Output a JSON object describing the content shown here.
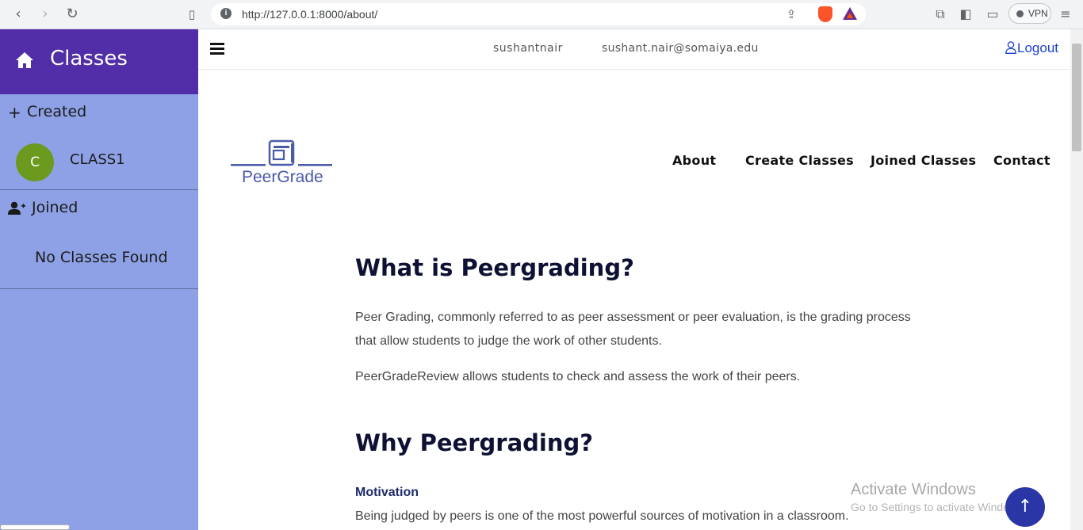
{
  "browser": {
    "url": "http://127.0.0.1:8000/about/",
    "vpn_label": "VPN"
  },
  "sidebar": {
    "title": "Classes",
    "created_label": "Created",
    "classes": [
      {
        "initial": "C",
        "name": "CLASS1",
        "avatar_color": "#6b9a1f"
      }
    ],
    "joined_label": "Joined",
    "no_classes": "No Classes Found"
  },
  "topbar": {
    "username": "sushantnair",
    "email": "sushant.nair@somaiya.edu",
    "logout": "Logout"
  },
  "site": {
    "logo_text": "PeerGrade",
    "nav": [
      "About",
      "Create Classes",
      "Joined Classes",
      "Contact"
    ]
  },
  "content": {
    "heading1": "What is Peergrading?",
    "para1_line1": "Peer Grading, commonly referred to as peer assessment or peer evaluation, is the grading process",
    "para1_line2": "that allow students to judge the work of other students.",
    "para2": "PeerGradeReview allows students to check and assess the work of their peers.",
    "heading2": "Why Peergrading?",
    "subheading": "Motivation",
    "para3": "Being judged by peers is one of the most powerful sources of motivation in a classroom."
  },
  "overlay": {
    "activate_title": "Activate Windows",
    "activate_sub": "Go to Settings to activate Windows."
  },
  "colors": {
    "sidebar_header": "#512da8",
    "sidebar_bg": "#8fa1e6",
    "accent": "#2b36a6",
    "logout": "#1a3fd1"
  }
}
